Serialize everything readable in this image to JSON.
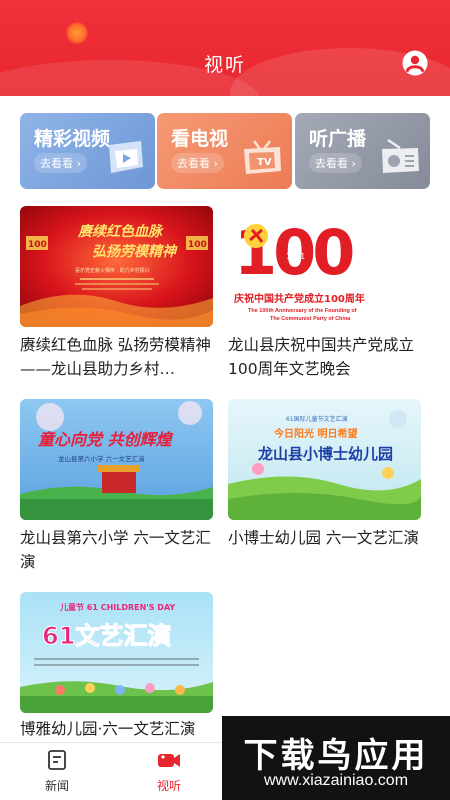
{
  "header": {
    "title": "视听",
    "user_icon": "user-avatar-icon"
  },
  "categories": [
    {
      "name": "精彩视频",
      "go": "去看看 ›",
      "icon": "video-play-icon",
      "color": "#7aa3df"
    },
    {
      "name": "看电视",
      "go": "去看看 ›",
      "icon": "tv-icon",
      "color": "#ef8660"
    },
    {
      "name": "听广播",
      "go": "去看看 ›",
      "icon": "radio-icon",
      "color": "#959aa8"
    }
  ],
  "videos": [
    {
      "caption": "赓续红色血脉 弘扬劳模精神 ——龙山县助力乡村…",
      "thumb": {
        "line1": "赓续红色血脉",
        "line2": "弘扬劳模精神",
        "sub": "喜乐党史薪火相传 · 助力乡村振兴",
        "badge": "100"
      }
    },
    {
      "caption": "龙山县庆祝中国共产党成立100周年文艺晚会",
      "thumb": {
        "big": "100",
        "y1": "1921",
        "y2": "2021",
        "cn": "庆祝中国共产党成立100周年",
        "en1": "The 100th Anniversary of the Founding of",
        "en2": "The Communist Party of China"
      }
    },
    {
      "caption": "龙山县第六小学 六一文艺汇演",
      "thumb": {
        "title": "童心向党 共创辉煌",
        "sub": "龙山县第六小学 六一文艺汇演"
      }
    },
    {
      "caption": "小博士幼儿园 六一文艺汇演",
      "thumb": {
        "top": "61国际儿童节文艺汇演",
        "mid": "今日阳光 明日希望",
        "title": "龙山县小博士幼儿园"
      }
    },
    {
      "caption": "博雅幼儿园·六一文艺汇演",
      "thumb": {
        "top": "儿童节 61 CHILDREN'S DAY",
        "title": "61文艺汇演"
      }
    }
  ],
  "tabbar": [
    {
      "label": "新闻",
      "icon": "news-icon",
      "active": false
    },
    {
      "label": "视听",
      "icon": "video-camera-icon",
      "active": true
    }
  ],
  "watermark": {
    "brand": "下载鸟应用",
    "url": "www.xiazainiao.com"
  }
}
